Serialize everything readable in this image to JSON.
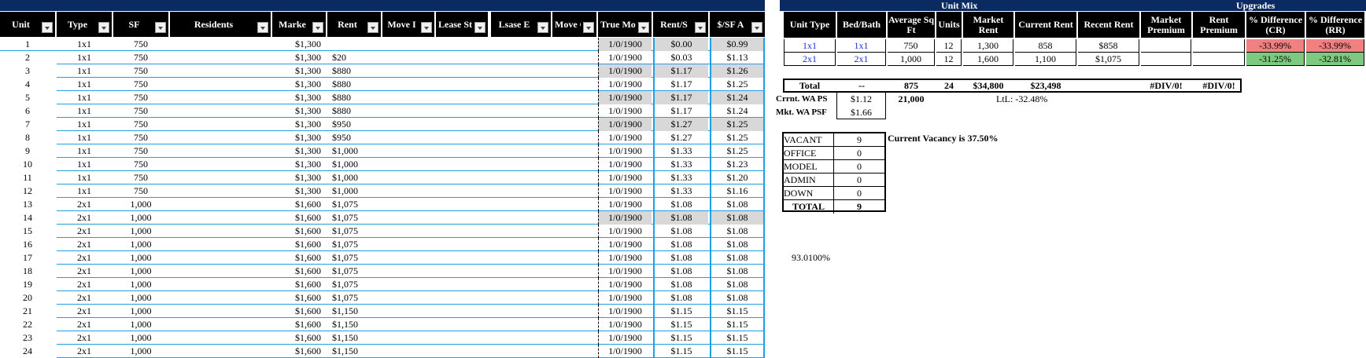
{
  "colors": {
    "header_bg": "#000000",
    "title_bar": "#0b2a62",
    "accent_line": "#1ea0e6",
    "gray_cell": "#d8d8d8",
    "pink": "#f28080",
    "green": "#7fc87f"
  },
  "rent_roll": {
    "headers": [
      "Unit",
      "Type",
      "SF",
      "Residents",
      "Marke",
      "Rent",
      "Move I",
      "Lease St",
      "Lsase E",
      "Move O",
      "True Mov",
      "Rent/S",
      "$/SF A"
    ],
    "rows": [
      {
        "unit": "1",
        "type": "1x1",
        "sf": "750",
        "market": "$1,300",
        "rent": "",
        "true_move": "1/0/1900",
        "rent_sf": "$0.00",
        "sf_avg": "$0.99"
      },
      {
        "unit": "2",
        "type": "1x1",
        "sf": "750",
        "market": "$1,300",
        "rent": "$20",
        "true_move": "1/0/1900",
        "rent_sf": "$0.03",
        "sf_avg": "$1.13"
      },
      {
        "unit": "3",
        "type": "1x1",
        "sf": "750",
        "market": "$1,300",
        "rent": "$880",
        "true_move": "1/0/1900",
        "rent_sf": "$1.17",
        "sf_avg": "$1.26"
      },
      {
        "unit": "4",
        "type": "1x1",
        "sf": "750",
        "market": "$1,300",
        "rent": "$880",
        "true_move": "1/0/1900",
        "rent_sf": "$1.17",
        "sf_avg": "$1.25"
      },
      {
        "unit": "5",
        "type": "1x1",
        "sf": "750",
        "market": "$1,300",
        "rent": "$880",
        "true_move": "1/0/1900",
        "rent_sf": "$1.17",
        "sf_avg": "$1.24"
      },
      {
        "unit": "6",
        "type": "1x1",
        "sf": "750",
        "market": "$1,300",
        "rent": "$880",
        "true_move": "1/0/1900",
        "rent_sf": "$1.17",
        "sf_avg": "$1.24"
      },
      {
        "unit": "7",
        "type": "1x1",
        "sf": "750",
        "market": "$1,300",
        "rent": "$950",
        "true_move": "1/0/1900",
        "rent_sf": "$1.27",
        "sf_avg": "$1.25"
      },
      {
        "unit": "8",
        "type": "1x1",
        "sf": "750",
        "market": "$1,300",
        "rent": "$950",
        "true_move": "1/0/1900",
        "rent_sf": "$1.27",
        "sf_avg": "$1.25"
      },
      {
        "unit": "9",
        "type": "1x1",
        "sf": "750",
        "market": "$1,300",
        "rent": "$1,000",
        "true_move": "1/0/1900",
        "rent_sf": "$1.33",
        "sf_avg": "$1.25"
      },
      {
        "unit": "10",
        "type": "1x1",
        "sf": "750",
        "market": "$1,300",
        "rent": "$1,000",
        "true_move": "1/0/1900",
        "rent_sf": "$1.33",
        "sf_avg": "$1.23"
      },
      {
        "unit": "11",
        "type": "1x1",
        "sf": "750",
        "market": "$1,300",
        "rent": "$1,000",
        "true_move": "1/0/1900",
        "rent_sf": "$1.33",
        "sf_avg": "$1.20"
      },
      {
        "unit": "12",
        "type": "1x1",
        "sf": "750",
        "market": "$1,300",
        "rent": "$1,000",
        "true_move": "1/0/1900",
        "rent_sf": "$1.33",
        "sf_avg": "$1.16"
      },
      {
        "unit": "13",
        "type": "2x1",
        "sf": "1,000",
        "market": "$1,600",
        "rent": "$1,075",
        "true_move": "1/0/1900",
        "rent_sf": "$1.08",
        "sf_avg": "$1.08"
      },
      {
        "unit": "14",
        "type": "2x1",
        "sf": "1,000",
        "market": "$1,600",
        "rent": "$1,075",
        "true_move": "1/0/1900",
        "rent_sf": "$1.08",
        "sf_avg": "$1.08"
      },
      {
        "unit": "15",
        "type": "2x1",
        "sf": "1,000",
        "market": "$1,600",
        "rent": "$1,075",
        "true_move": "1/0/1900",
        "rent_sf": "$1.08",
        "sf_avg": "$1.08"
      },
      {
        "unit": "16",
        "type": "2x1",
        "sf": "1,000",
        "market": "$1,600",
        "rent": "$1,075",
        "true_move": "1/0/1900",
        "rent_sf": "$1.08",
        "sf_avg": "$1.08"
      },
      {
        "unit": "17",
        "type": "2x1",
        "sf": "1,000",
        "market": "$1,600",
        "rent": "$1,075",
        "true_move": "1/0/1900",
        "rent_sf": "$1.08",
        "sf_avg": "$1.08"
      },
      {
        "unit": "18",
        "type": "2x1",
        "sf": "1,000",
        "market": "$1,600",
        "rent": "$1,075",
        "true_move": "1/0/1900",
        "rent_sf": "$1.08",
        "sf_avg": "$1.08"
      },
      {
        "unit": "19",
        "type": "2x1",
        "sf": "1,000",
        "market": "$1,600",
        "rent": "$1,075",
        "true_move": "1/0/1900",
        "rent_sf": "$1.08",
        "sf_avg": "$1.08"
      },
      {
        "unit": "20",
        "type": "2x1",
        "sf": "1,000",
        "market": "$1,600",
        "rent": "$1,075",
        "true_move": "1/0/1900",
        "rent_sf": "$1.08",
        "sf_avg": "$1.08"
      },
      {
        "unit": "21",
        "type": "2x1",
        "sf": "1,000",
        "market": "$1,600",
        "rent": "$1,150",
        "true_move": "1/0/1900",
        "rent_sf": "$1.15",
        "sf_avg": "$1.15"
      },
      {
        "unit": "22",
        "type": "2x1",
        "sf": "1,000",
        "market": "$1,600",
        "rent": "$1,150",
        "true_move": "1/0/1900",
        "rent_sf": "$1.15",
        "sf_avg": "$1.15"
      },
      {
        "unit": "23",
        "type": "2x1",
        "sf": "1,000",
        "market": "$1,600",
        "rent": "$1,150",
        "true_move": "1/0/1900",
        "rent_sf": "$1.15",
        "sf_avg": "$1.15"
      },
      {
        "unit": "24",
        "type": "2x1",
        "sf": "1,000",
        "market": "$1,600",
        "rent": "$1,150",
        "true_move": "1/0/1900",
        "rent_sf": "$1.15",
        "sf_avg": "$1.15"
      }
    ],
    "gray_rows": [
      1,
      3,
      5,
      7,
      14
    ]
  },
  "unit_mix": {
    "title": "Unit Mix",
    "upgrades_title": "Upgrades",
    "headers": [
      "Unit Type",
      "Bed/Bath",
      "Average Sq Ft",
      "Units",
      "Market Rent",
      "Current Rent",
      "Recent Rent",
      "Market Premium",
      "Rent Premium",
      "% Difference (CR)",
      "% Difference (RR)"
    ],
    "rows": [
      {
        "type": "1x1",
        "bed": "1x1",
        "sqft": "750",
        "units": "12",
        "market": "1,300",
        "current": "858",
        "recent": "$858",
        "mprem": "",
        "rprem": "",
        "dcr": "-33.99%",
        "drr": "-33.99%",
        "tone": "pink"
      },
      {
        "type": "2x1",
        "bed": "2x1",
        "sqft": "1,000",
        "units": "12",
        "market": "1,600",
        "current": "1,100",
        "recent": "$1,075",
        "mprem": "",
        "rprem": "",
        "dcr": "-31.25%",
        "drr": "-32.81%",
        "tone": "green"
      }
    ],
    "total": {
      "label": "Total",
      "bed": "--",
      "sqft": "875",
      "units": "24",
      "market": "$34,800",
      "current": "$23,498",
      "mprem": "#DIV/0!",
      "rprem": "#DIV/0!"
    },
    "crnt_wa_label": "Crrnt. WA PS",
    "crnt_wa_value": "$1.12",
    "sf_total": "21,000",
    "ltl": "LtL:  -32.48%",
    "mkt_wa_label": "Mkt. WA PSF",
    "mkt_wa_value": "$1.66"
  },
  "vacancy": {
    "rows": [
      {
        "label": "VACANT",
        "value": "9"
      },
      {
        "label": "OFFICE",
        "value": "0"
      },
      {
        "label": "MODEL",
        "value": "0"
      },
      {
        "label": "ADMIN",
        "value": "0"
      },
      {
        "label": "DOWN",
        "value": "0"
      }
    ],
    "total_label": "TOTAL",
    "total_value": "9",
    "note": "Current Vacancy is 37.50%",
    "pct": "93.0100%"
  }
}
